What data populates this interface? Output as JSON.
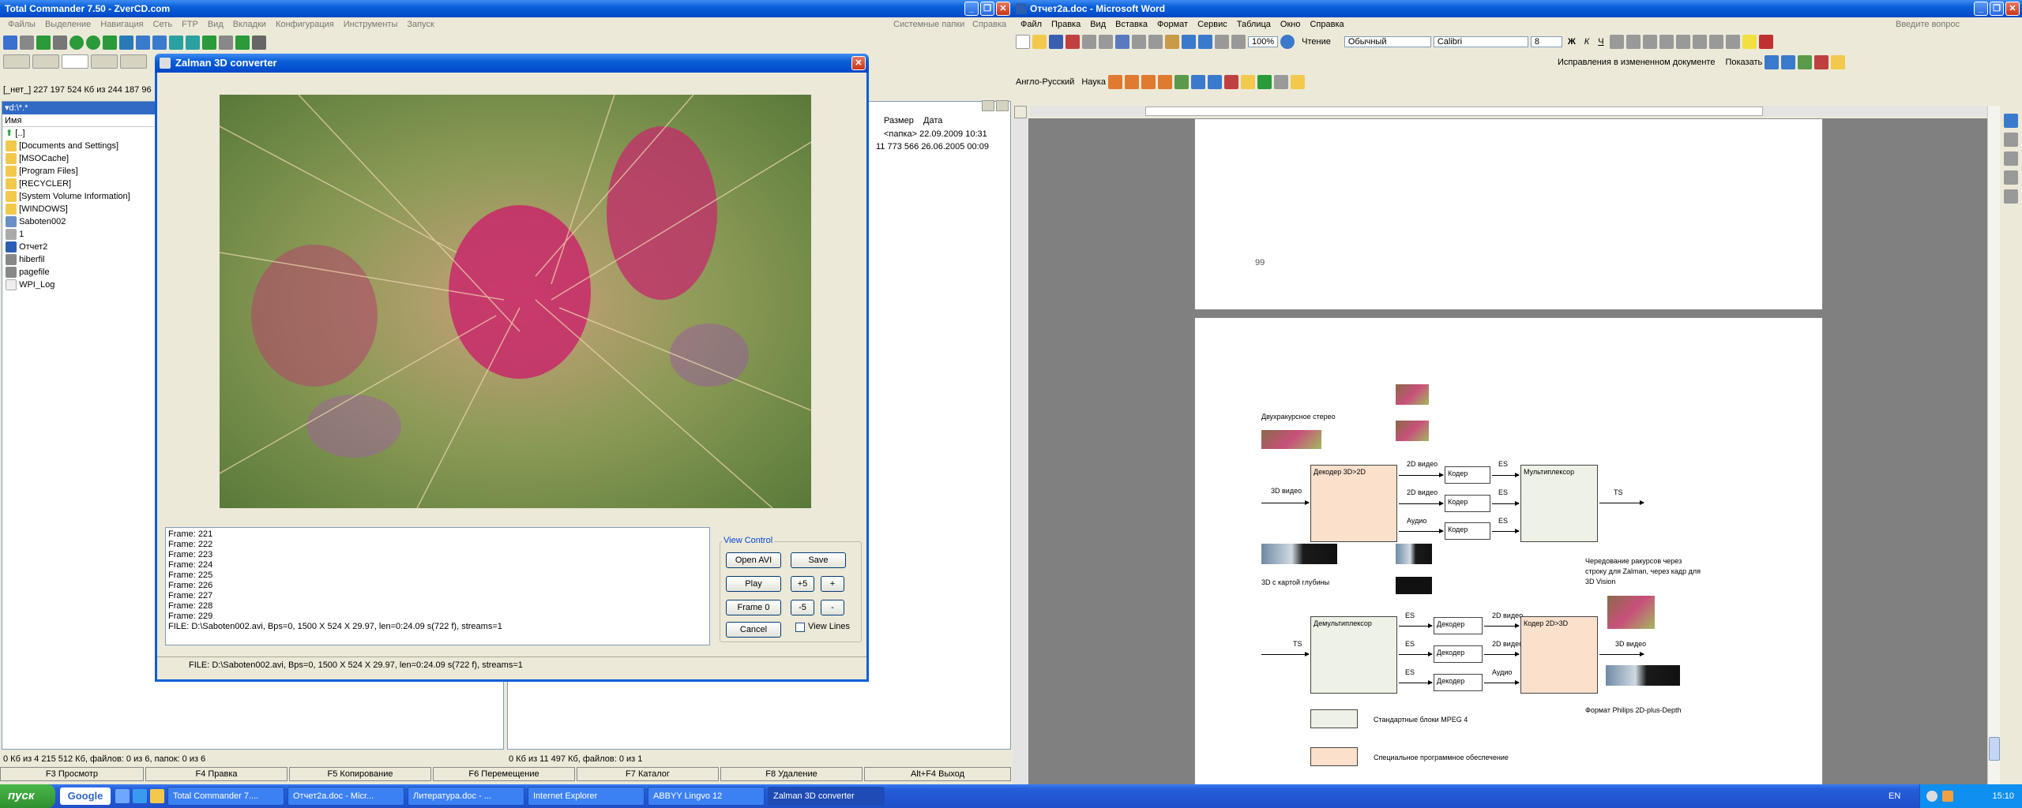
{
  "tc": {
    "title": "Total Commander 7.50 - ZverCD.com",
    "menu": [
      "Файлы",
      "Выделение",
      "Навигация",
      "Сеть",
      "FTP",
      "Вид",
      "Вкладки",
      "Конфигурация",
      "Инструменты",
      "Запуск"
    ],
    "menu_right": [
      "Системные папки",
      "Справка"
    ],
    "drive_info": "[_нет_]  227 197 524 Кб из 244 187 96",
    "path": "▾d:\\*.*",
    "col_name": "Имя",
    "files": [
      "[..]",
      "[Documents and Settings]",
      "[MSOCache]",
      "[Program Files]",
      "[RECYCLER]",
      "[System Volume Information]",
      "[WINDOWS]",
      "Saboten002",
      "1",
      "Отчет2",
      "hiberfil",
      "pagefile",
      "WPI_Log"
    ],
    "right_cols": {
      "size": "Размер",
      "date": "Дата"
    },
    "right_rows": [
      {
        "size": "<папка>",
        "date": "22.09.2009 10:31"
      },
      {
        "size": "11 773 566",
        "date": "26.06.2005 00:09"
      }
    ],
    "status_left": "0 Кб из 4 215 512 Кб, файлов: 0 из 6, папок: 0 из 6",
    "status_right": "0 Кб из 11 497 Кб, файлов: 0 из 1",
    "fkeys": [
      "F3 Просмотр",
      "F4 Правка",
      "F5 Копирование",
      "F6 Перемещение",
      "F7 Каталог",
      "F8 Удаление",
      "Alt+F4 Выход"
    ]
  },
  "dlg": {
    "title": "Zalman 3D converter",
    "log": [
      "Frame: 221",
      "Frame: 222",
      "Frame: 223",
      "Frame: 224",
      "Frame: 225",
      "Frame: 226",
      "Frame: 227",
      "Frame: 228",
      "Frame: 229",
      "FILE:   D:\\Saboten002.avi,  Bps=0,  1500 X 524 X 29.97,  len=0:24.09 s(722 f),  streams=1"
    ],
    "group": "View Control",
    "btn_open": "Open AVI",
    "btn_save": "Save",
    "btn_play": "Play",
    "btn_p5": "+5",
    "btn_plus": "+",
    "btn_frame0": "Frame 0",
    "btn_m5": "-5",
    "btn_minus": "-",
    "btn_cancel": "Cancel",
    "view_lines": "View Lines",
    "status": "FILE:   D:\\Saboten002.avi,  Bps=0,  1500 X 524 X 29.97,  len=0:24.09 s(722 f),  streams=1"
  },
  "word": {
    "title": "Отчет2а.doc - Microsoft Word",
    "menu": [
      "Файл",
      "Правка",
      "Вид",
      "Вставка",
      "Формат",
      "Сервис",
      "Таблица",
      "Окно",
      "Справка"
    ],
    "help_box": "Введите вопрос",
    "zoom": "100%",
    "read": "Чтение",
    "style": "Обычный",
    "font": "Calibri",
    "size": "8",
    "track": "Исправления в измененном документе",
    "show": "Показать",
    "lang": "Англо-Русский",
    "science": "Наука",
    "page_num": "99",
    "d": {
      "dual": "Двухракурсное стерео",
      "in3d": "3D видео",
      "dec": "Декодер 3D>2D",
      "v2d_1": "2D видео",
      "v2d_2": "2D видео",
      "audio1": "Аудио",
      "coder": "Кодер",
      "es": "ES",
      "mux": "Мультиплексор",
      "ts": "TS",
      "depth": "3D с картой глубины",
      "note": "Чередование ракурсов через строку для Zalman, через кадр для 3D Vision",
      "demux": "Демультиплексор",
      "decoder": "Декодер",
      "coder2": "Кодер 2D>3D",
      "v2d_3": "2D видео",
      "v2d_4": "2D видео",
      "audio2": "Аудио",
      "out3d": "3D видео",
      "philips": "Формат Philips 2D-plus-Depth",
      "legend1": "Стандартные блоки MPEG 4",
      "legend2": "Специальное программное обеспечение"
    }
  },
  "taskbar": {
    "start": "пуск",
    "google": "Google",
    "tasks": [
      "Total Commander 7....",
      "Отчет2а.doc - Micr...",
      "Литература.doc - ...",
      "Internet Explorer",
      "ABBYY Lingvo 12",
      "Zalman 3D converter"
    ],
    "lang": "EN",
    "time": "15:10"
  },
  "colors": {
    "orange": "#fbe0cc",
    "green": "#eef2e6",
    "accent": "#0a5fd8"
  }
}
